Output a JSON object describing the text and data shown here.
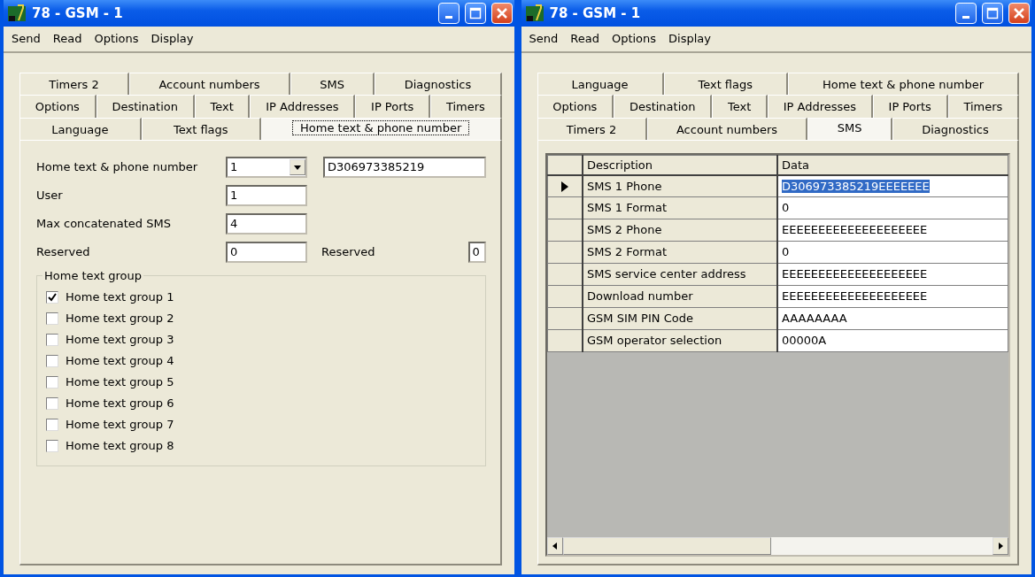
{
  "windows": [
    {
      "title": "78 - GSM - 1",
      "menu": [
        "Send",
        "Read",
        "Options",
        "Display"
      ],
      "tab_rows": [
        [
          {
            "label": "Timers 2",
            "selected": false
          },
          {
            "label": "Account numbers",
            "selected": false
          },
          {
            "label": "SMS",
            "selected": false
          },
          {
            "label": "Diagnostics",
            "selected": false
          }
        ],
        [
          {
            "label": "Options",
            "selected": false
          },
          {
            "label": "Destination",
            "selected": false
          },
          {
            "label": "Text",
            "selected": false
          },
          {
            "label": "IP Addresses",
            "selected": false
          },
          {
            "label": "IP Ports",
            "selected": false
          },
          {
            "label": "Timers",
            "selected": false
          }
        ],
        [
          {
            "label": "Language",
            "selected": false
          },
          {
            "label": "Text flags",
            "selected": false
          },
          {
            "label": "Home text & phone number",
            "selected": true
          }
        ]
      ],
      "form": {
        "home_label": "Home text & phone number",
        "home_combo": "1",
        "home_text": "D306973385219",
        "user_label": "User",
        "user": "1",
        "max_label": "Max concatenated SMS",
        "max": "4",
        "reserved_label": "Reserved",
        "reserved": "0",
        "reserved2_label": "Reserved",
        "reserved2": "0",
        "group": {
          "title": "Home text group",
          "items": [
            {
              "label": "Home text group 1",
              "checked": true
            },
            {
              "label": "Home text group 2",
              "checked": false
            },
            {
              "label": "Home text group 3",
              "checked": false
            },
            {
              "label": "Home text group 4",
              "checked": false
            },
            {
              "label": "Home text group 5",
              "checked": false
            },
            {
              "label": "Home text group 6",
              "checked": false
            },
            {
              "label": "Home text group 7",
              "checked": false
            },
            {
              "label": "Home text group 8",
              "checked": false
            }
          ]
        }
      }
    },
    {
      "title": "78 - GSM - 1",
      "menu": [
        "Send",
        "Read",
        "Options",
        "Display"
      ],
      "tab_rows": [
        [
          {
            "label": "Language",
            "selected": false
          },
          {
            "label": "Text flags",
            "selected": false
          },
          {
            "label": "Home text & phone number",
            "selected": false
          }
        ],
        [
          {
            "label": "Options",
            "selected": false
          },
          {
            "label": "Destination",
            "selected": false
          },
          {
            "label": "Text",
            "selected": false
          },
          {
            "label": "IP Addresses",
            "selected": false
          },
          {
            "label": "IP Ports",
            "selected": false
          },
          {
            "label": "Timers",
            "selected": false
          }
        ],
        [
          {
            "label": "Timers 2",
            "selected": false
          },
          {
            "label": "Account numbers",
            "selected": false
          },
          {
            "label": "SMS",
            "selected": true
          },
          {
            "label": "Diagnostics",
            "selected": false
          }
        ]
      ],
      "grid": {
        "columns": [
          "Description",
          "Data"
        ],
        "rows": [
          {
            "description": "SMS 1 Phone",
            "data": "D306973385219EEEEEEE",
            "selected": true
          },
          {
            "description": "SMS 1  Format",
            "data": "0",
            "selected": false
          },
          {
            "description": "SMS 2 Phone",
            "data": "EEEEEEEEEEEEEEEEEEEE",
            "selected": false
          },
          {
            "description": "SMS 2 Format",
            "data": "0",
            "selected": false
          },
          {
            "description": "SMS service center address",
            "data": "EEEEEEEEEEEEEEEEEEEE",
            "selected": false
          },
          {
            "description": "Download number",
            "data": "EEEEEEEEEEEEEEEEEEEE",
            "selected": false
          },
          {
            "description": "GSM SIM PIN Code",
            "data": "AAAAAAAA",
            "selected": false
          },
          {
            "description": "GSM operator selection",
            "data": "00000A",
            "selected": false
          }
        ]
      }
    }
  ]
}
